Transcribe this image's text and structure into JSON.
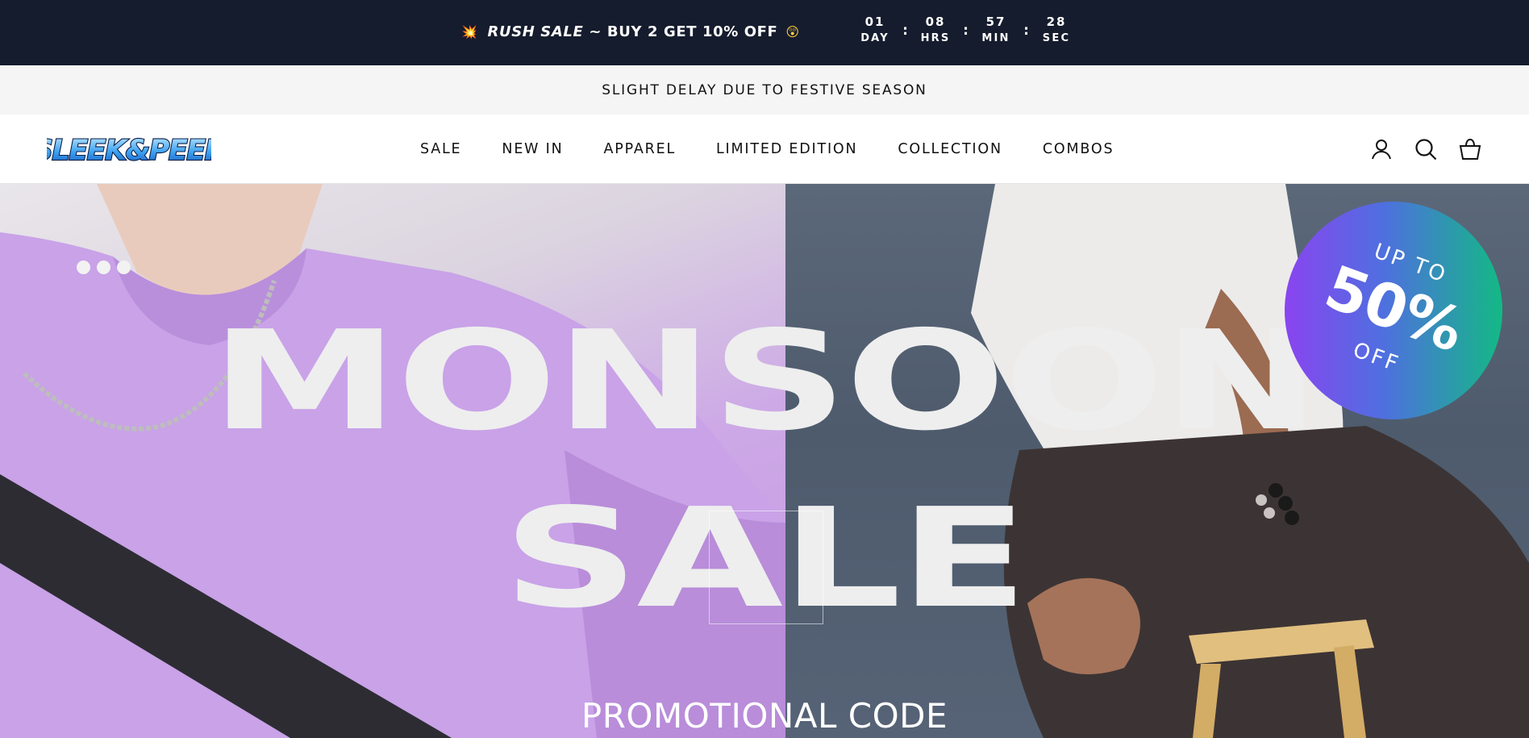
{
  "announcement": {
    "emoji_start": "💥",
    "promo_italic": "RUSH SALE",
    "promo_rest": "~ BUY 2 GET 10% OFF",
    "emoji_end": "😲",
    "countdown": [
      {
        "value": "01",
        "label": "DAY"
      },
      {
        "value": "08",
        "label": "HRS"
      },
      {
        "value": "57",
        "label": "MIN"
      },
      {
        "value": "28",
        "label": "SEC"
      }
    ],
    "separator": ":"
  },
  "notice": {
    "text": "SLIGHT DELAY DUE TO FESTIVE SEASON"
  },
  "header": {
    "logo_text": "SLEEK&PEEK",
    "nav": [
      "SALE",
      "NEW IN",
      "APPAREL",
      "LIMITED EDITION",
      "COLLECTION",
      "COMBOS"
    ],
    "icons": [
      "account-icon",
      "search-icon",
      "cart-icon"
    ]
  },
  "hero": {
    "title_line1": "MONSOON",
    "title_line2": "SALE",
    "subtitle": "PROMOTIONAL CODE",
    "badge": {
      "top": "UP TO",
      "big": "50%",
      "bottom": "OFF"
    },
    "slide_count": 3
  },
  "colors": {
    "topbar_bg": "#151c2d",
    "notice_bg": "#f5f5f5",
    "badge_gradient": [
      "#8a44f0",
      "#4f6fe0",
      "#13b985"
    ],
    "hero_left": "#c397e2",
    "hero_right": "#4e5b6d"
  }
}
